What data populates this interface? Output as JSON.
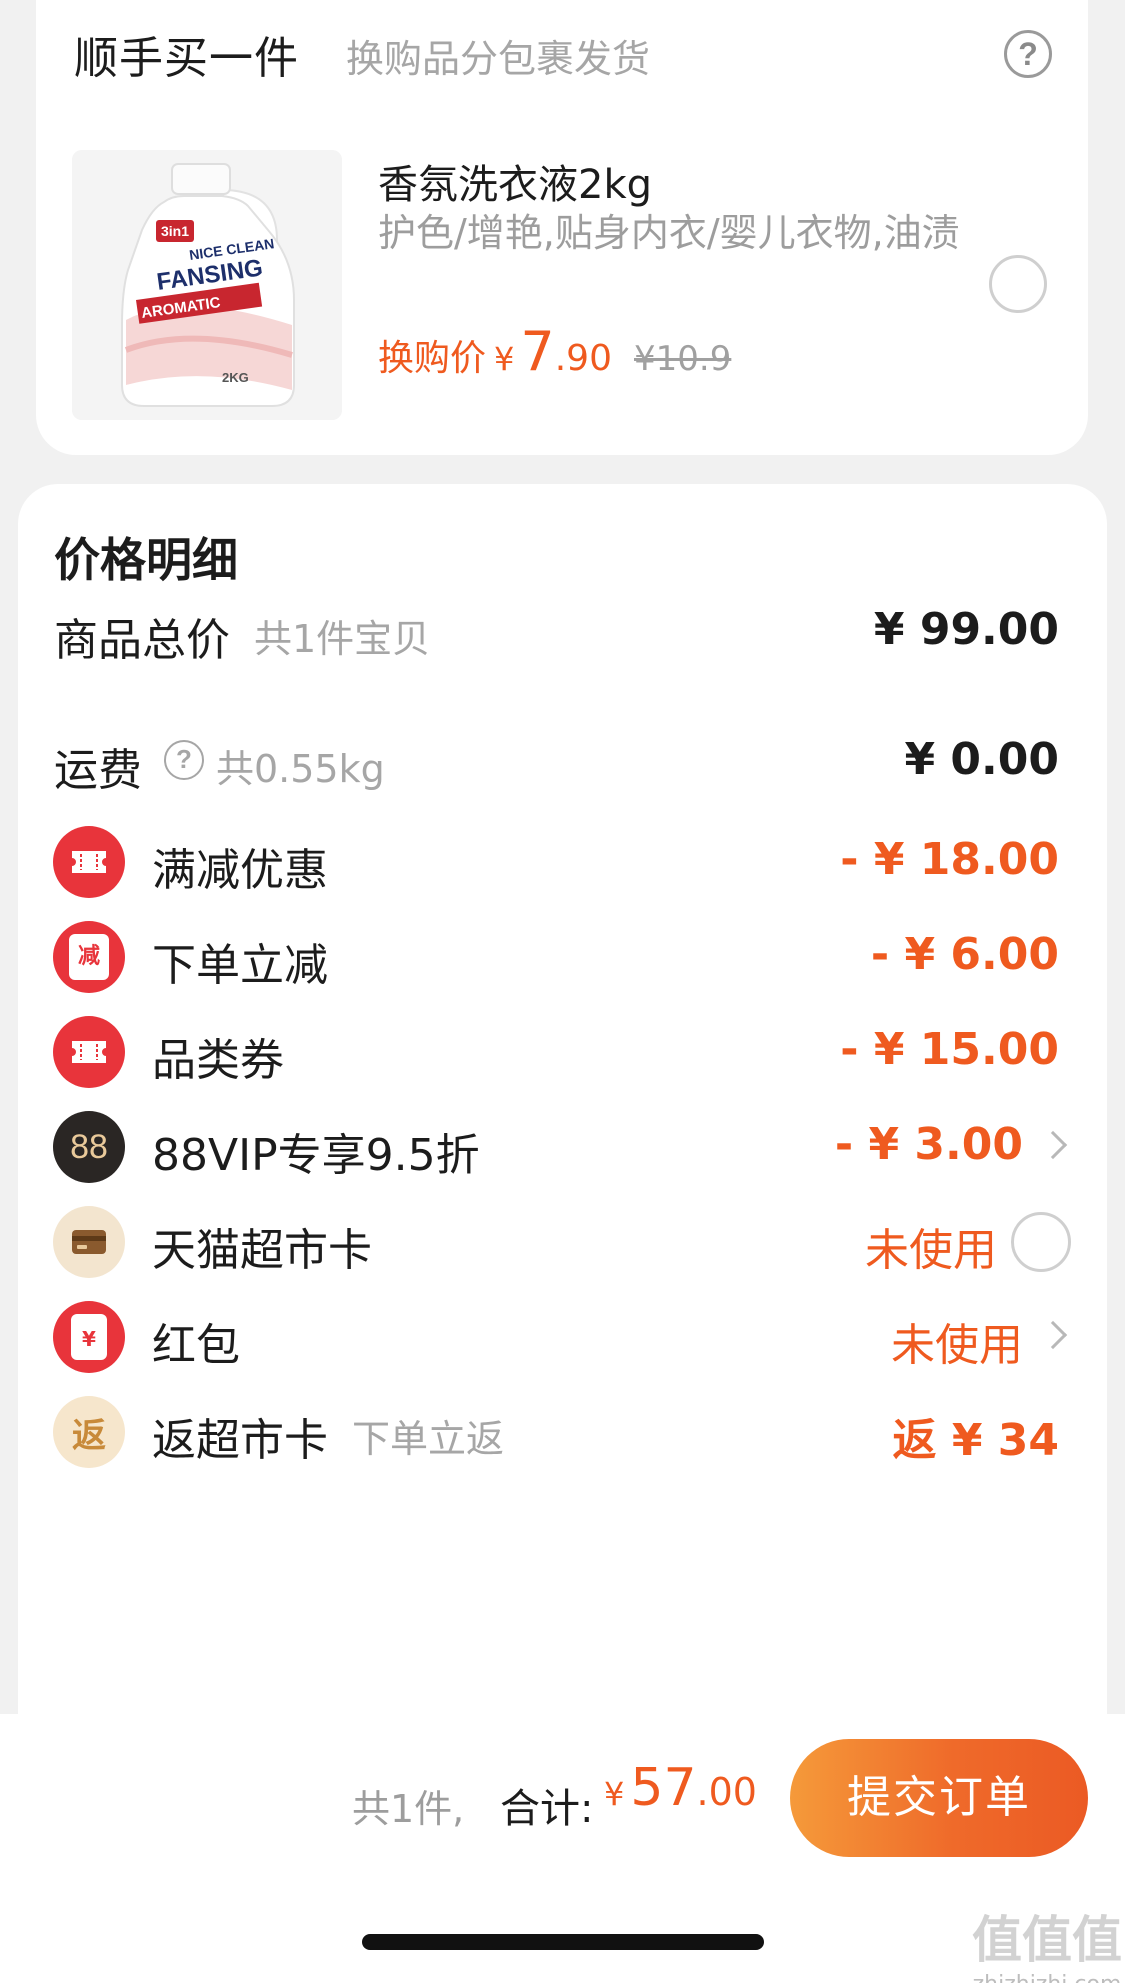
{
  "addon": {
    "title": "顺手买一件",
    "subtitle": "换购品分包裹发货",
    "help": "?",
    "product": {
      "name": "香氛洗衣液2kg",
      "desc": "护色/增艳,贴身内衣/婴儿衣物,油渍",
      "price_label": "换购价",
      "price_yen": "¥",
      "price_int": "7",
      "price_dec": ".90",
      "old_price": "¥10.9",
      "image_text": {
        "badge": "3in1",
        "brand": "FANSING",
        "tag": "NICE CLEAN",
        "line": "AROMATIC",
        "weight": "2KG"
      }
    }
  },
  "detail": {
    "title": "价格明细",
    "rows": [
      {
        "label": "商品总价",
        "hint": "共1件宝贝",
        "value": "¥ 99.00"
      },
      {
        "label": "运费",
        "help": "?",
        "hint": "共0.55kg",
        "value": "¥ 0.00"
      },
      {
        "label": "满减优惠",
        "icon": "ticket-icon",
        "value": "- ¥ 18.00"
      },
      {
        "label": "下单立减",
        "icon": "instant-discount-icon",
        "icon_text": "减",
        "value": "- ¥ 6.00"
      },
      {
        "label": "品类券",
        "icon": "ticket-icon",
        "value": "- ¥ 15.00"
      },
      {
        "label": "88VIP专享9.5折",
        "icon": "88vip-icon",
        "icon_text": "88",
        "value": "- ¥ 3.00"
      },
      {
        "label": "天猫超市卡",
        "icon": "card-icon",
        "value": "未使用"
      },
      {
        "label": "红包",
        "icon": "red-packet-icon",
        "icon_text": "¥",
        "value": "未使用"
      },
      {
        "label": "返超市卡",
        "icon": "rebate-icon",
        "icon_text": "返",
        "hint": "下单立返",
        "value": "返 ¥ 34"
      }
    ]
  },
  "footer": {
    "count": "共1件,",
    "total_label": "合计:",
    "total_yen": "¥",
    "total_int": "57",
    "total_dec": ".00",
    "submit": "提交订单"
  },
  "watermark": {
    "glyphs": "值值值",
    "text": "zhizhizhi.com"
  },
  "colors": {
    "accent": "#ef5a1f",
    "icon_red": "#e8343b",
    "vip_dark": "#2a2624",
    "gold_bg": "#f3e5cf",
    "gray_text": "#a6a6a6"
  }
}
